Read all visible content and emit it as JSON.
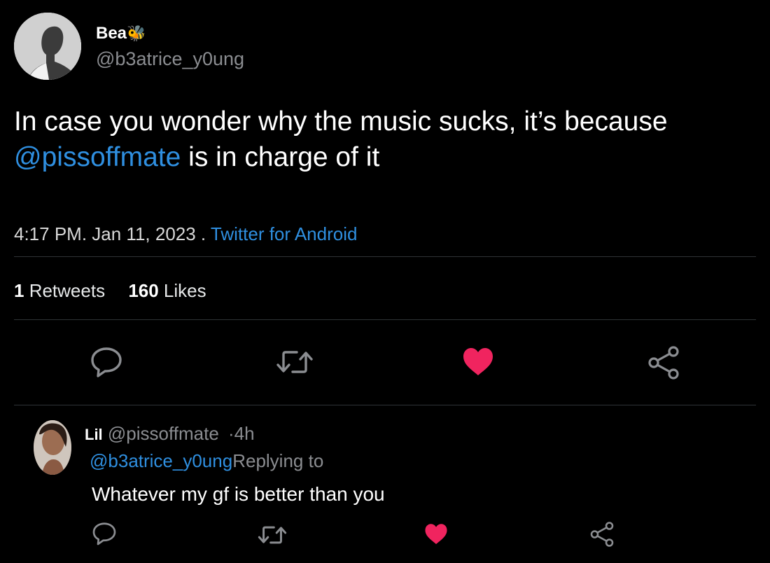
{
  "tweet": {
    "author_name": "Bea",
    "author_emoji": "🐝",
    "author_handle": "@b3atrice_y0ung",
    "text_part1": "In case you wonder why the music sucks, it’s because",
    "mention": "@pissoffmate",
    "text_part2": " is in charge of it",
    "time": "4:17 PM",
    "date_sep": ". Jan 11, 2023 . ",
    "source": "Twitter for Android",
    "retweets_count": "1",
    "retweets_label": " Retweets",
    "likes_count": "160",
    "likes_label": " Likes",
    "liked": true
  },
  "reply": {
    "author_name": "Lil",
    "author_handle": "@pissoffmate",
    "age": "·4h",
    "replying_to_handle": "@b3atrice_y0ung",
    "replying_to_label": "Replying to",
    "text": "Whatever my gf is better than you",
    "liked": true
  },
  "colors": {
    "background": "#000000",
    "link": "#2f8fe0",
    "like": "#f0245f",
    "icon": "#8b8d91",
    "divider": "#2f3336"
  },
  "icons": {
    "reply": "speech-bubble-icon",
    "retweet": "retweet-arrows-icon",
    "like": "heart-icon",
    "share": "share-nodes-icon"
  }
}
